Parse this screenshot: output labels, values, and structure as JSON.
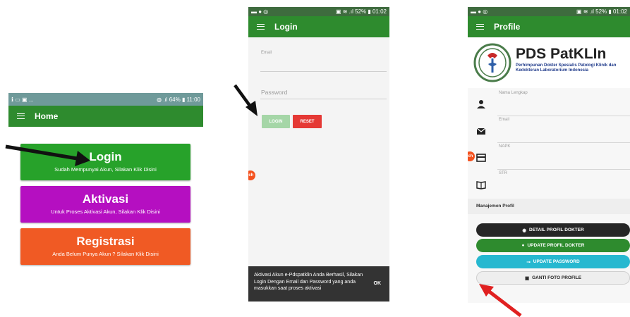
{
  "phone1": {
    "status": {
      "left": "ℹ ▭ ▣ ...",
      "right": "◍ .ıl 64% ▮ 11:00"
    },
    "appbar_title": "Home",
    "buttons": [
      {
        "title": "Login",
        "subtitle": "Sudah Mempunyai Akun, Silakan Klik Disini",
        "color": "#27a22a"
      },
      {
        "title": "Aktivasi",
        "subtitle": "Untuk Proses Aktivasi Akun, Silakan Klik Disini",
        "color": "#b50fc1"
      },
      {
        "title": "Registrasi",
        "subtitle": "Anda Belum Punya Akun ? Silakan Klik Disini",
        "color": "#f05a24"
      }
    ]
  },
  "phone2": {
    "status": {
      "left": "▬ ● ◎",
      "right": "▣ ≋ .ıl 52% ▮ 01:02"
    },
    "appbar_title": "Login",
    "email_label": "Email",
    "password_placeholder": "Password",
    "login_label": "LOGIN",
    "reset_label": "RESET",
    "float_label": "lch",
    "snackbar_text": "Aktivasi Akun e-Pdspatklin Anda Berhasil, Silakan Login Dengan Email dan Password yang anda masukkan saat proses aktivasi",
    "snackbar_action": "OK",
    "colors": {
      "login": "#a5d6a7",
      "reset": "#e53935"
    }
  },
  "phone3": {
    "status": {
      "left": "▬ ● ◎",
      "right": "▣ ≋ .ıl 52% ▮ 01:02"
    },
    "appbar_title": "Profile",
    "logo_title": "PDS PatKLIn",
    "logo_subtitle": "Perhimpunan Dokter Spesialis Patologi Klinik dan Kedokteran Laboratorium Indonesia",
    "fields": [
      {
        "label": "Nama Lengkap",
        "icon": "person-icon"
      },
      {
        "label": "Email",
        "icon": "mail-icon"
      },
      {
        "label": "NAPK",
        "icon": "card-icon"
      },
      {
        "label": "STR",
        "icon": "book-icon"
      }
    ],
    "float_label": "lch",
    "section_title": "Manajemen Profil",
    "buttons": [
      {
        "label": "DETAIL PROFIL DOKTER",
        "icon": "eye-icon",
        "bg": "#262626",
        "fg": "#ffffff"
      },
      {
        "label": "UPDATE PROFIL DOKTER",
        "icon": "account-circle-icon",
        "bg": "#2e8b2e",
        "fg": "#ffffff"
      },
      {
        "label": "UPDATE PASSWORD",
        "icon": "key-icon",
        "bg": "#26b8d0",
        "fg": "#ffffff"
      },
      {
        "label": "GANTI FOTO PROFILE",
        "icon": "image-icon",
        "bg": "#eeeeee",
        "fg": "#222222"
      }
    ]
  },
  "annotations": {
    "arrow_black": "#111111",
    "arrow_red": "#e02020"
  }
}
